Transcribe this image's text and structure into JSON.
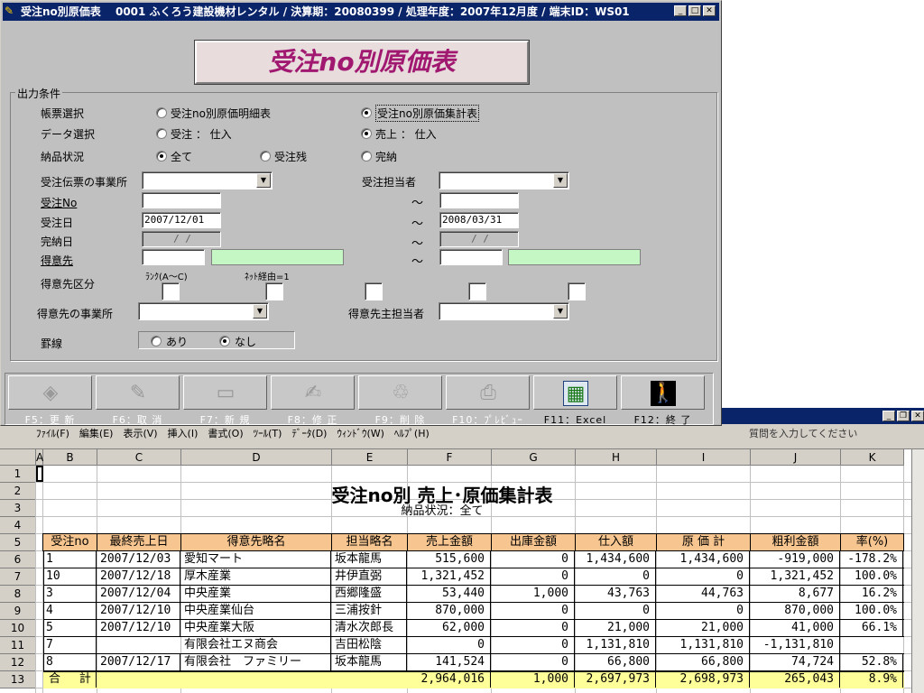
{
  "dialog": {
    "title": "受注no別原価表　 0001 ふくろう建設機材レンタル / 決算期：20080399 / 処理年度：2007年12月度 / 端末ID：WS01",
    "banner": "受注no別原価表",
    "group_title": "出力条件",
    "labels": {
      "report": "帳票選択",
      "data": "データ選択",
      "delivery": "納品状況",
      "office": "受注伝票の事業所",
      "staff": "受注担当者",
      "order_no": "受注No",
      "order_date": "受注日",
      "complete_date": "完納日",
      "customer": "得意先",
      "cust_class": "得意先区分",
      "rank": "ﾗﾝｸ(A～C)",
      "net": "ﾈｯﾄ経由=1",
      "cust_office": "得意先の事業所",
      "cust_staff": "得意先主担当者",
      "ruled": "罫線"
    },
    "radios": {
      "report_detail": "受注no別原価明細表",
      "report_summary": "受注no別原価集計表",
      "data_order": "受注 ： 仕入",
      "data_sales": "売上 ： 仕入",
      "deliv_all": "全て",
      "deliv_remain": "受注残",
      "deliv_done": "完納",
      "ruled_yes": "あり",
      "ruled_no": "なし"
    },
    "fields": {
      "order_date_from": "2007/12/01",
      "order_date_to": "2008/03/31",
      "complete_from": "/ /",
      "complete_to": "/ /",
      "tilde": "～"
    },
    "buttons": [
      {
        "label": "F5：更 新",
        "icon": "update-icon"
      },
      {
        "label": "F6：取 消",
        "icon": "cancel-icon"
      },
      {
        "label": "F7：新 規",
        "icon": "new-icon"
      },
      {
        "label": "F8：修 正",
        "icon": "edit-icon"
      },
      {
        "label": "F9：削 除",
        "icon": "delete-icon"
      },
      {
        "label": "F10：ﾌﾟﾚﾋﾞｭｰ",
        "icon": "printer-icon"
      },
      {
        "label": "F11：Excel",
        "icon": "excel-icon"
      },
      {
        "label": "F12：終 了",
        "icon": "exit-icon"
      }
    ]
  },
  "excel": {
    "menu": "ﾌｧｲﾙ(F)　編集(E)　表示(V)　挿入(I)　書式(O)　ﾂｰﾙ(T)　ﾃﾞｰﾀ(D)　ｳｨﾝﾄﾞｳ(W)　ﾍﾙﾌﾟ(H)",
    "ask": "質問を入力してください",
    "columns": [
      "A",
      "B",
      "C",
      "D",
      "E",
      "F",
      "G",
      "H",
      "I",
      "J",
      "K"
    ],
    "rows": [
      "1",
      "2",
      "3",
      "4",
      "5",
      "6",
      "7",
      "8",
      "9",
      "10",
      "11",
      "12",
      "13"
    ],
    "sheet_title": "受注no別 売上･原価集計表",
    "sheet_subtitle": "納品状況：全て",
    "headers": [
      "受注no",
      "最終売上日",
      "得意先略名",
      "担当略名",
      "売上金額",
      "出庫金額",
      "仕入額",
      "原 価 計",
      "粗利金額",
      "率(%)"
    ],
    "data_rows": [
      [
        "1",
        "2007/12/03",
        "愛知マート",
        "坂本龍馬",
        "515,600",
        "0",
        "1,434,600",
        "1,434,600",
        "-919,000",
        "-178.2%"
      ],
      [
        "10",
        "2007/12/18",
        "厚木産業",
        "井伊直弼",
        "1,321,452",
        "0",
        "0",
        "0",
        "1,321,452",
        "100.0%"
      ],
      [
        "3",
        "2007/12/04",
        "中央産業",
        "西郷隆盛",
        "53,440",
        "1,000",
        "43,763",
        "44,763",
        "8,677",
        "16.2%"
      ],
      [
        "4",
        "2007/12/10",
        "中央産業仙台",
        "三浦按針",
        "870,000",
        "0",
        "0",
        "0",
        "870,000",
        "100.0%"
      ],
      [
        "5",
        "2007/12/10",
        "中央産業大阪",
        "清水次郎長",
        "62,000",
        "0",
        "21,000",
        "21,000",
        "41,000",
        "66.1%"
      ],
      [
        "7",
        "",
        "有限会社エヌ商会",
        "吉田松陰",
        "0",
        "0",
        "1,131,810",
        "1,131,810",
        "-1,131,810",
        ""
      ],
      [
        "8",
        "2007/12/17",
        "有限会社　ファミリー",
        "坂本龍馬",
        "141,524",
        "0",
        "66,800",
        "66,800",
        "74,724",
        "52.8%"
      ]
    ],
    "total_row": [
      "合　 計",
      "",
      "",
      "",
      "2,964,016",
      "1,000",
      "2,697,973",
      "2,698,973",
      "265,043",
      "8.9%"
    ],
    "colors": {
      "header_fill": "#f7c58f",
      "total_fill": "#ffff99"
    }
  }
}
